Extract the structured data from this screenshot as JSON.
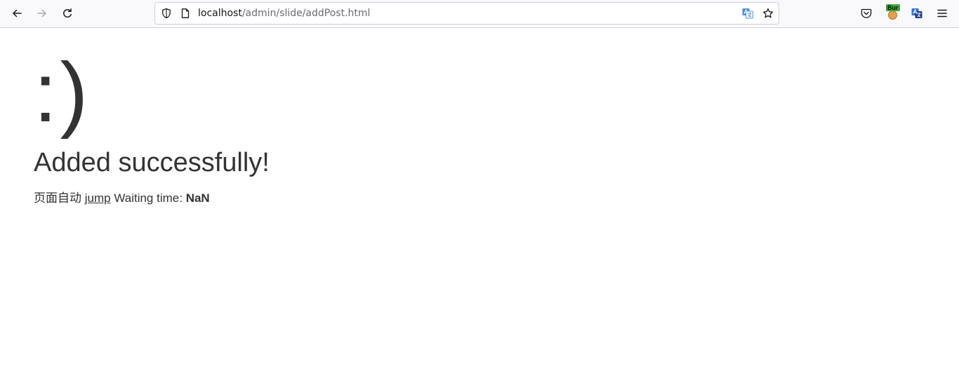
{
  "browser": {
    "url_host": "localhost",
    "url_path": "/admin/slide/addPost.html",
    "extension_badge": "Bur"
  },
  "icons": {
    "back": "arrow-left-icon",
    "forward": "arrow-right-icon",
    "reload": "reload-icon",
    "tracking_protection": "shield-icon",
    "page_info": "page-icon",
    "translate": "translate-icon",
    "bookmark": "star-icon",
    "pocket": "pocket-icon",
    "extension": "extension-icon",
    "translate_ext": "translate-icon",
    "menu": "hamburger-menu-icon"
  },
  "page": {
    "emoticon": ":)",
    "title": "Added successfully!",
    "redirect_prefix": "页面自动",
    "jump_link": "jump",
    "waiting_label": "Waiting time:",
    "wait_value": "NaN"
  },
  "colors": {
    "text": "#333333",
    "toolbar_bg": "#f9f9fb",
    "badge_green": "#3da93d"
  }
}
